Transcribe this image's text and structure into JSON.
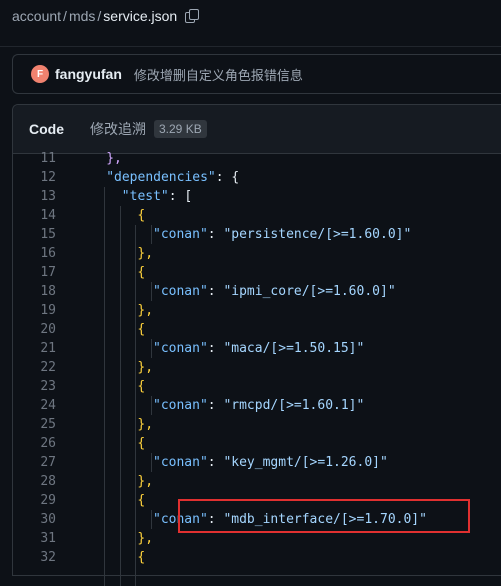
{
  "breadcrumb": {
    "part1": "account",
    "sep": "/",
    "part2": "mds",
    "current": "service.json"
  },
  "commit": {
    "avatar_letter": "F",
    "author": "fangyufan",
    "message": "修改增删自定义角色报错信息"
  },
  "file": {
    "tab_code": "Code",
    "tab_blame": "修改追溯",
    "size": "3.29 KB"
  },
  "code_lines": [
    {
      "num": "11",
      "indent": 4,
      "text": "},"
    },
    {
      "num": "12",
      "indent": 4,
      "key": "\"dependencies\"",
      "after": ": {"
    },
    {
      "num": "13",
      "indent": 6,
      "key": "\"test\"",
      "after": ": ["
    },
    {
      "num": "14",
      "indent": 8,
      "text": "{"
    },
    {
      "num": "15",
      "indent": 10,
      "key": "\"conan\"",
      "colon": ": ",
      "value": "\"persistence/[>=1.60.0]\""
    },
    {
      "num": "16",
      "indent": 8,
      "text": "},"
    },
    {
      "num": "17",
      "indent": 8,
      "text": "{"
    },
    {
      "num": "18",
      "indent": 10,
      "key": "\"conan\"",
      "colon": ": ",
      "value": "\"ipmi_core/[>=1.60.0]\""
    },
    {
      "num": "19",
      "indent": 8,
      "text": "},"
    },
    {
      "num": "20",
      "indent": 8,
      "text": "{"
    },
    {
      "num": "21",
      "indent": 10,
      "key": "\"conan\"",
      "colon": ": ",
      "value": "\"maca/[>=1.50.15]\""
    },
    {
      "num": "22",
      "indent": 8,
      "text": "},"
    },
    {
      "num": "23",
      "indent": 8,
      "text": "{"
    },
    {
      "num": "24",
      "indent": 10,
      "key": "\"conan\"",
      "colon": ": ",
      "value": "\"rmcpd/[>=1.60.1]\""
    },
    {
      "num": "25",
      "indent": 8,
      "text": "},"
    },
    {
      "num": "26",
      "indent": 8,
      "text": "{"
    },
    {
      "num": "27",
      "indent": 10,
      "key": "\"conan\"",
      "colon": ": ",
      "value": "\"key_mgmt/[>=1.26.0]\""
    },
    {
      "num": "28",
      "indent": 8,
      "text": "},"
    },
    {
      "num": "29",
      "indent": 8,
      "text": "{"
    },
    {
      "num": "30",
      "indent": 10,
      "key": "\"conan\"",
      "colon": ": ",
      "value": "\"mdb_interface/[>=1.70.0]\""
    },
    {
      "num": "31",
      "indent": 8,
      "text": "},"
    },
    {
      "num": "32",
      "indent": 8,
      "text": "{"
    }
  ],
  "colors": {
    "highlight": "#e03030",
    "key": "#79c0ff",
    "string": "#a5d6ff",
    "avatar": "#f0826f"
  },
  "icons": {
    "copy": "copy-icon"
  }
}
